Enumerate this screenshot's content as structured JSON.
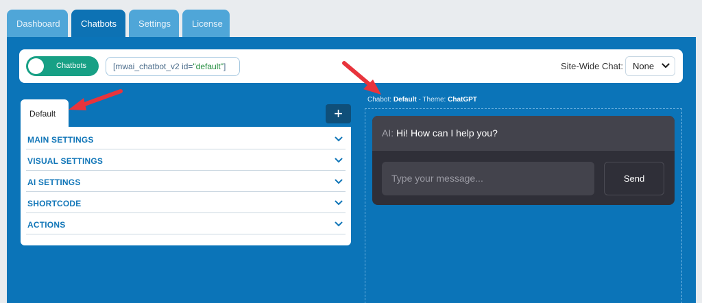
{
  "tabs": [
    {
      "label": "Dashboard"
    },
    {
      "label": "Chatbots",
      "active": true
    },
    {
      "label": "Settings"
    },
    {
      "label": "License"
    }
  ],
  "topbar": {
    "toggle_label": "Chatbots",
    "toggle_on": true,
    "shortcode_prefix": "[mwai_chatbot_v2 id=",
    "shortcode_value": "\"default\"",
    "shortcode_suffix": "]",
    "sitewide_label": "Site-Wide Chat:",
    "sitewide_value": "None"
  },
  "chatbot_tab": {
    "label": "Default"
  },
  "add_button": {
    "label": "+"
  },
  "accordion": [
    {
      "label": "MAIN SETTINGS"
    },
    {
      "label": "VISUAL SETTINGS"
    },
    {
      "label": "AI SETTINGS"
    },
    {
      "label": "SHORTCODE"
    },
    {
      "label": "ACTIONS"
    }
  ],
  "preview": {
    "title_prefix": "Chabot: ",
    "bot_name": "Default",
    "theme_prefix": " - Theme: ",
    "theme_name": "ChatGPT"
  },
  "chat": {
    "ai_tag": "AI:",
    "greeting": " Hi! How can I help you?",
    "input_placeholder": "Type your message...",
    "send_label": "Send"
  },
  "colors": {
    "panel_blue": "#0b74b8",
    "tab_active": "#0d72b4",
    "toggle_green": "#17a085",
    "annotation_red": "#e8343c",
    "chat_bg": "#2f2f38"
  },
  "icons": {
    "accordion_chevron": "chevron-down-icon",
    "select_chevron": "chevron-down-icon",
    "annotation": "red-arrow-icon"
  }
}
